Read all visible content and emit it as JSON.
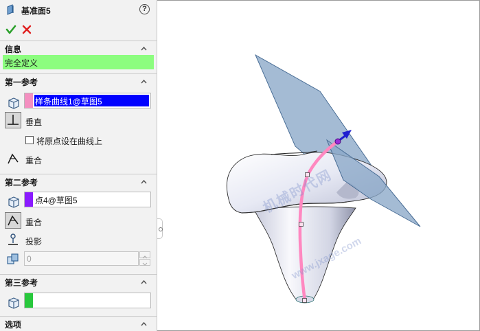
{
  "panel": {
    "title": "基准面5",
    "help": "?",
    "sections": {
      "info": {
        "label": "信息",
        "status": "完全定义"
      },
      "first_ref": {
        "label": "第一参考",
        "selection": "样条曲线1@草图5",
        "swatch_color": "#f48fc0",
        "options": {
          "perpendicular": "垂直",
          "set_origin_on_curve": "将原点设在曲线上",
          "coincident": "重合"
        }
      },
      "second_ref": {
        "label": "第二参考",
        "selection": "点4@草图5",
        "swatch_color": "#8a1aff",
        "options": {
          "coincident": "重合",
          "project": "投影"
        },
        "distance_value": "0"
      },
      "third_ref": {
        "label": "第三参考",
        "selection": "",
        "swatch_color": "#28c83c"
      },
      "options": {
        "label": "选项"
      }
    }
  },
  "watermark": {
    "line1": "机械时代网",
    "line2": "www.jxage.com"
  },
  "colors": {
    "status_bg": "#8cfd7f",
    "selection_highlight": "#0000ff",
    "plane_fill": "#8aa8c8",
    "spline": "#ff88c0",
    "arrow": "#2020d0"
  }
}
